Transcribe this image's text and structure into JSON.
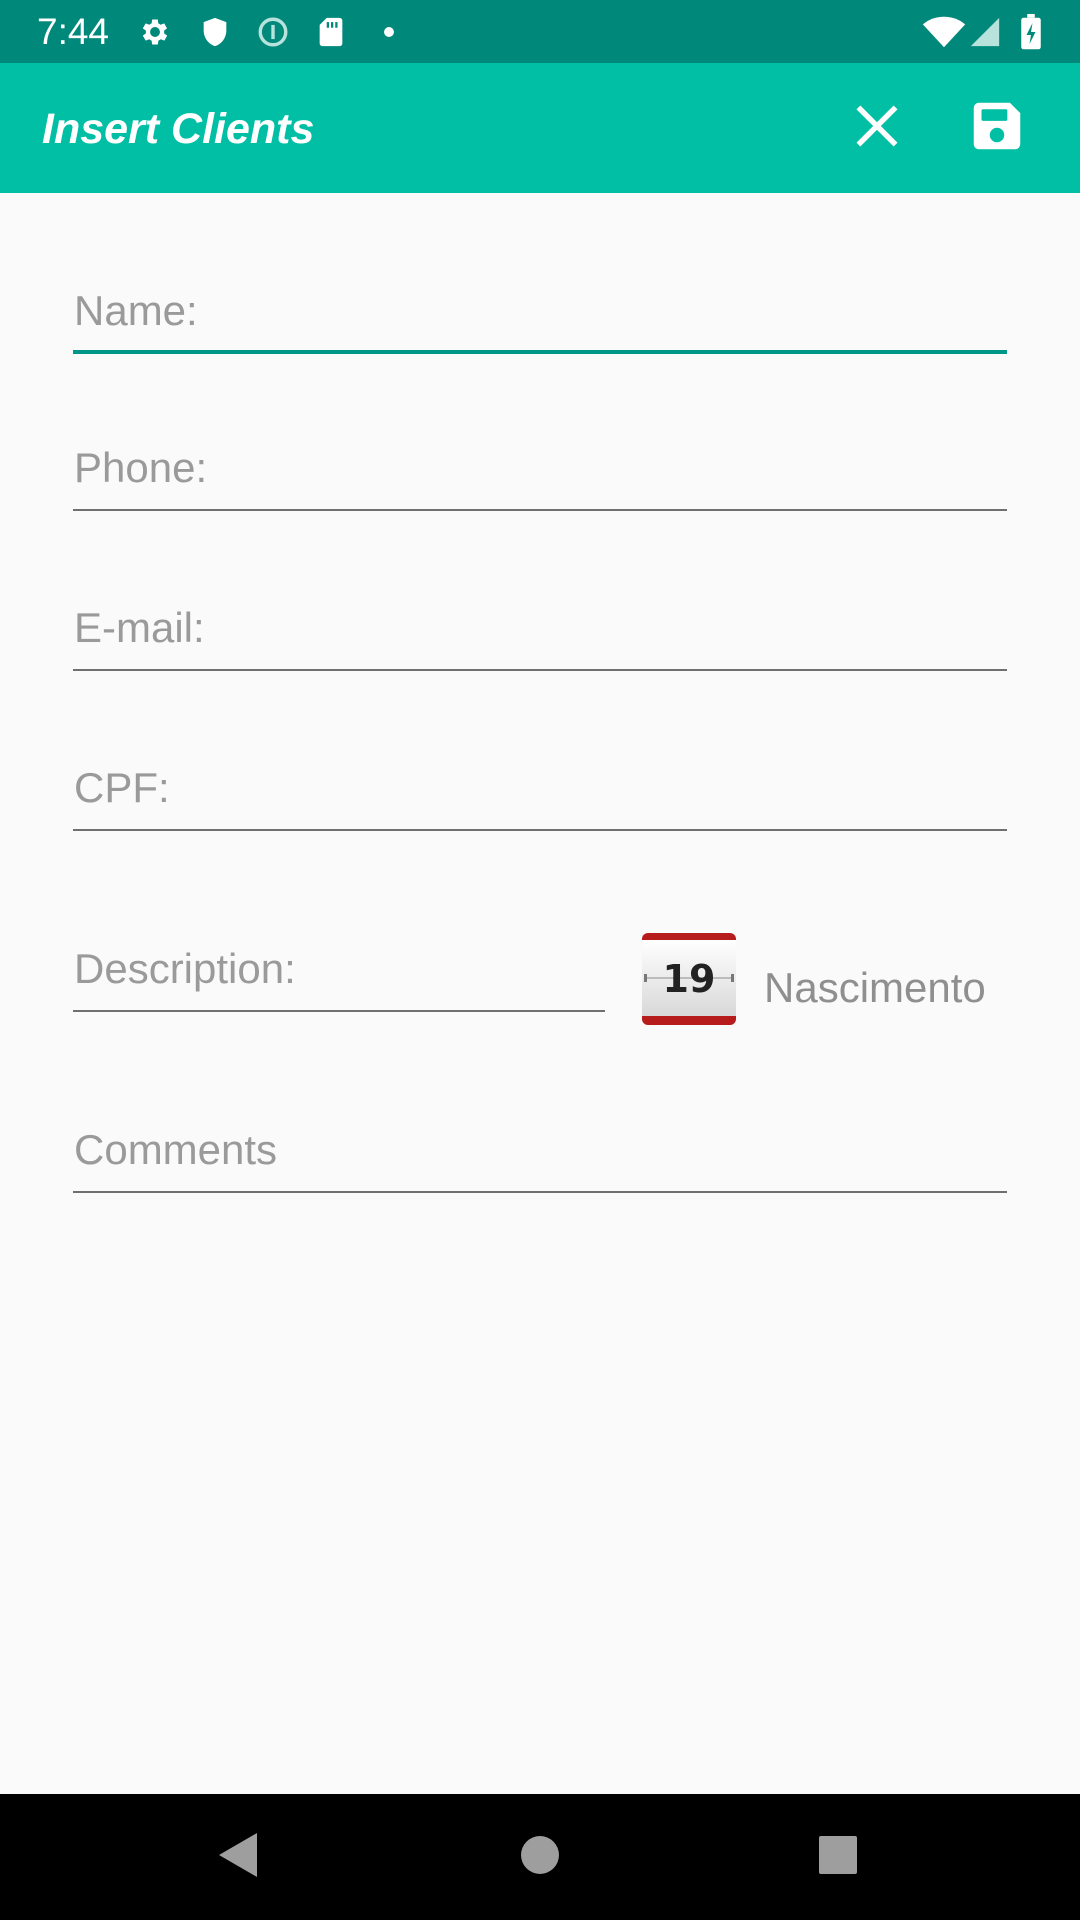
{
  "status_bar": {
    "time": "7:44",
    "left_icons": [
      "settings-icon",
      "shield-icon",
      "info-circle-icon",
      "sd-card-icon",
      "dot-icon"
    ],
    "right_icons": [
      "wifi-icon",
      "signal-icon",
      "battery-charging-icon"
    ],
    "background_color": "#00887a"
  },
  "app_bar": {
    "title": "Insert Clients",
    "background_color": "#00bfa5",
    "actions": [
      {
        "icon": "close-icon",
        "name": "close"
      },
      {
        "icon": "save-icon",
        "name": "save"
      }
    ]
  },
  "form": {
    "name_placeholder": "Name:",
    "phone_placeholder": "Phone:",
    "email_placeholder": "E-mail:",
    "cpf_placeholder": "CPF:",
    "description_placeholder": "Description:",
    "comments_placeholder": "Comments",
    "birth_date": {
      "calendar_day": "19",
      "label": "Nascimento"
    },
    "accent_color": "#00968a"
  },
  "nav_bar": {
    "buttons": [
      "back-icon",
      "home-icon",
      "recents-icon"
    ]
  }
}
